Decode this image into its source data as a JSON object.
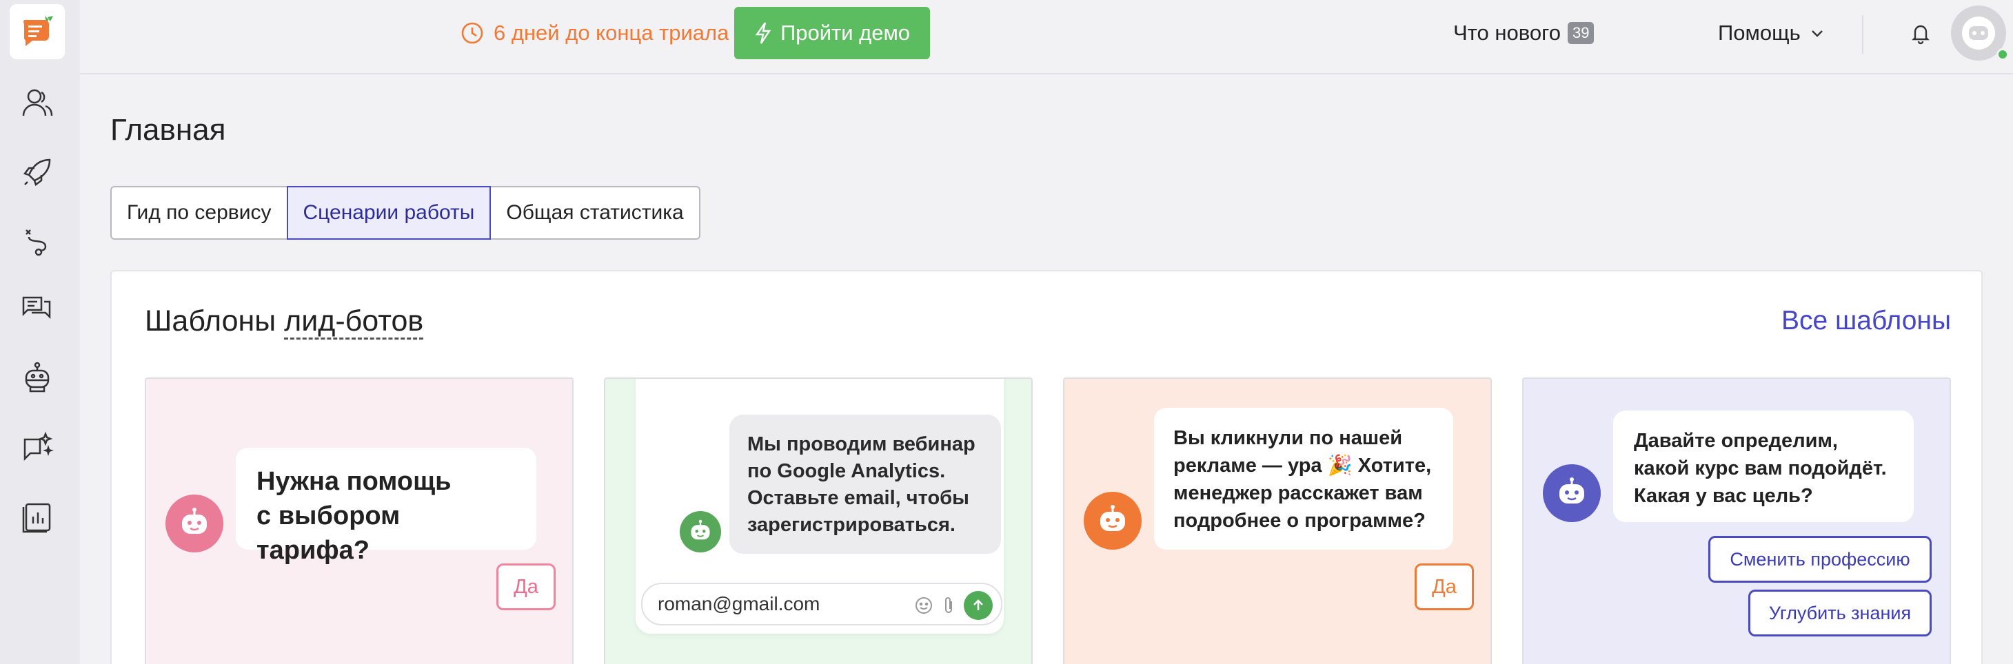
{
  "header": {
    "trial_text": "6 дней до конца триала",
    "demo_button": "Пройти демо",
    "whats_new": "Что нового",
    "whats_new_count": "39",
    "help": "Помощь"
  },
  "page": {
    "title": "Главная",
    "tabs": [
      {
        "label": "Гид по сервису",
        "active": false
      },
      {
        "label": "Сценарии работы",
        "active": true
      },
      {
        "label": "Общая статистика",
        "active": false
      }
    ]
  },
  "templates": {
    "title_prefix": "Шаблоны",
    "title_link": "лид-ботов",
    "all_link": "Все шаблоны",
    "cards": [
      {
        "bubble_lines": [
          "Нужна помощь",
          "с выбором тарифа?"
        ],
        "answers": [
          "Да"
        ],
        "accent": "#ea7c97"
      },
      {
        "bubble_lines": [
          "Мы проводим вебинар",
          "по Google Analytics.",
          "Оставьте email, чтобы",
          "зарегистрироваться."
        ],
        "input_value": "roman@gmail.com",
        "accent": "#58a85c"
      },
      {
        "bubble_lines": [
          "Вы кликнули по нашей",
          "рекламе — ура 🎉 Хотите,",
          "менеджер расскажет вам",
          "подробнее о программе?"
        ],
        "answers": [
          "Да"
        ],
        "accent": "#f07a35"
      },
      {
        "bubble_lines": [
          "Давайте определим,",
          "какой курс вам подойдёт.",
          "Какая у вас цель?"
        ],
        "answers": [
          "Сменить профессию",
          "Углубить знания"
        ],
        "accent": "#5b5bc4"
      }
    ]
  },
  "colors": {
    "trial": "#f07a35",
    "demo_button": "#5cbd60",
    "link": "#4646c8",
    "active_tab": "#4a4ac2"
  },
  "icons": {
    "sidebar": [
      "users-icon",
      "rocket-icon",
      "route-icon",
      "chat-icon",
      "bot-icon",
      "sparkle-chat-icon",
      "analytics-icon"
    ],
    "header": [
      "clock-icon",
      "bolt-icon",
      "chevron-down-icon",
      "bell-icon",
      "avatar-icon"
    ]
  }
}
